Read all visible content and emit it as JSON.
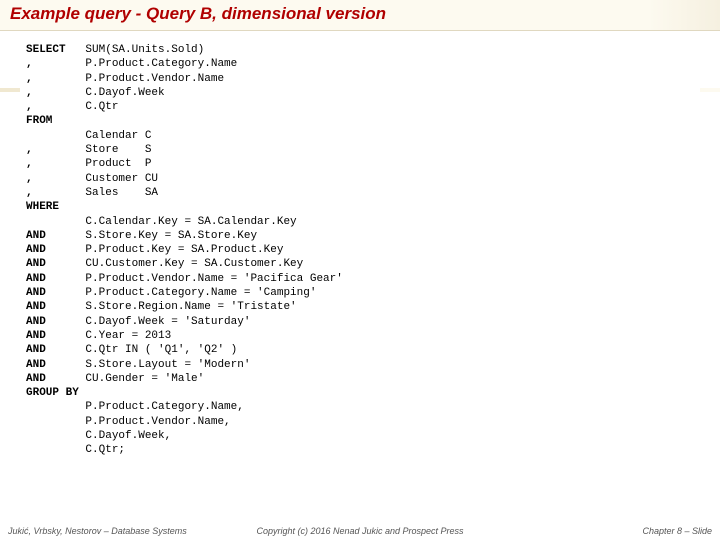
{
  "title": "Example query  -  Query B, dimensional version",
  "code": {
    "l1k": "SELECT",
    "l1v": "SUM(SA.Units.Sold)",
    "l2k": ",",
    "l2v": "P.Product.Category.Name",
    "l3k": ",",
    "l3v": "P.Product.Vendor.Name",
    "l4k": ",",
    "l4v": "C.Dayof.Week",
    "l5k": ",",
    "l5v": "C.Qtr",
    "l6k": "FROM",
    "l6v": "",
    "l7k": "",
    "l7v": "Calendar C",
    "l8k": ",",
    "l8v": "Store    S",
    "l9k": ",",
    "l9v": "Product  P",
    "l10k": ",",
    "l10v": "Customer CU",
    "l11k": ",",
    "l11v": "Sales    SA",
    "l12k": "WHERE",
    "l12v": "",
    "l13k": "",
    "l13v": "C.Calendar.Key = SA.Calendar.Key",
    "l14k": "AND",
    "l14v": "S.Store.Key = SA.Store.Key",
    "l15k": "AND",
    "l15v": "P.Product.Key = SA.Product.Key",
    "l16k": "AND",
    "l16v": "CU.Customer.Key = SA.Customer.Key",
    "l17k": "AND",
    "l17v": "P.Product.Vendor.Name = 'Pacifica Gear'",
    "l18k": "AND",
    "l18v": "P.Product.Category.Name = 'Camping'",
    "l19k": "AND",
    "l19v": "S.Store.Region.Name = 'Tristate'",
    "l20k": "AND",
    "l20v": "C.Dayof.Week = 'Saturday'",
    "l21k": "AND",
    "l21v": "C.Year = 2013",
    "l22k": "AND",
    "l22v": "C.Qtr IN ( 'Q1', 'Q2' )",
    "l23k": "AND",
    "l23v": "S.Store.Layout = 'Modern'",
    "l24k": "AND",
    "l24v": "CU.Gender = 'Male'",
    "l25k": "GROUP BY",
    "l25v": "",
    "l26k": "",
    "l26v": "P.Product.Category.Name,",
    "l27k": "",
    "l27v": "P.Product.Vendor.Name,",
    "l28k": "",
    "l28v": "C.Dayof.Week,",
    "l29k": "",
    "l29v": "C.Qtr;"
  },
  "footer": {
    "left": "Jukić, Vrbsky, Nestorov – Database Systems",
    "center": "Copyright (c) 2016 Nenad Jukic and Prospect Press",
    "right": "Chapter 8 – Slide"
  }
}
